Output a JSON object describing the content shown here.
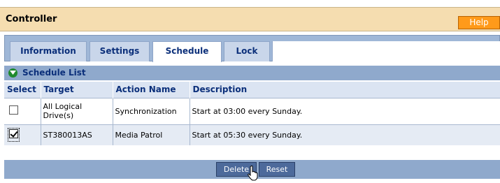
{
  "header": {
    "title": "Controller",
    "help_label": "Help"
  },
  "tabs": [
    {
      "label": "Information",
      "active": false
    },
    {
      "label": "Settings",
      "active": false
    },
    {
      "label": "Schedule",
      "active": true
    },
    {
      "label": "Lock",
      "active": false
    }
  ],
  "section": {
    "title": "Schedule List",
    "icon": "green-circle-down-arrow-icon"
  },
  "table": {
    "headers": [
      "Select",
      "Target",
      "Action Name",
      "Description"
    ],
    "rows": [
      {
        "checked": false,
        "target": "All Logical Drive(s)",
        "action": "Synchronization",
        "description": "Start at 03:00 every Sunday."
      },
      {
        "checked": true,
        "target": "ST380013AS",
        "action": "Media Patrol",
        "description": "Start at 05:30 every Sunday."
      }
    ]
  },
  "buttons": {
    "delete_label": "Delete",
    "reset_label": "Reset"
  },
  "colors": {
    "header_bg": "#f5ddb0",
    "help_bg": "#ff9a1a",
    "tab_text": "#0b2f7a",
    "bar_bg": "#8fa9cc",
    "button_bg": "#4d6a9b"
  }
}
